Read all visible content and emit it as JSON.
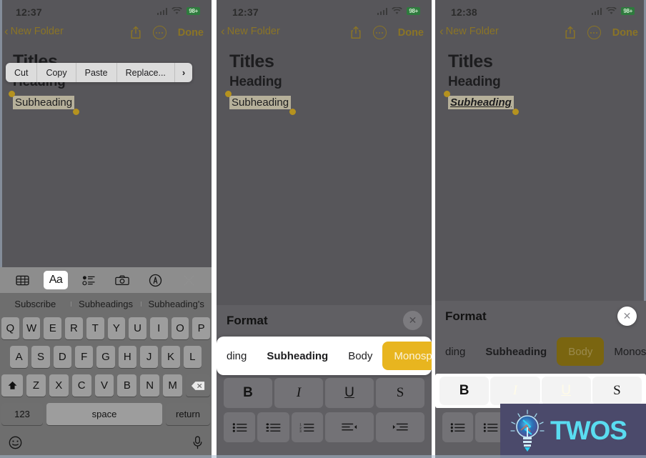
{
  "meta": {
    "accent_gold": "#8a7426",
    "selection_yellow": "#e8b51f",
    "body_bg": "#57565a",
    "battery_green": "#2f7a3e"
  },
  "panels": [
    {
      "id": "panel-1",
      "status": {
        "time": "12:37",
        "battery": "98+",
        "wifi_icon": "wifi-icon",
        "signal_icon": "cellular-signal-icon"
      },
      "nav": {
        "back_label": "New Folder",
        "back_icon": "chevron-left-icon",
        "share_icon": "share-icon",
        "more_icon": "more-ellipsis-icon",
        "done_label": "Done"
      },
      "note": {
        "title": "Titles",
        "heading": "Heading",
        "subheading": "Subheading"
      },
      "edit_menu": {
        "items": [
          "Cut",
          "Copy",
          "Paste",
          "Replace..."
        ],
        "more_icon": "chevron-right-icon"
      },
      "keyboard": {
        "toolbar": [
          {
            "name": "table-icon",
            "label": "",
            "active": false
          },
          {
            "name": "format-aa-icon",
            "label": "Aa",
            "active": true
          },
          {
            "name": "checklist-icon",
            "label": "",
            "active": false
          },
          {
            "name": "camera-icon",
            "label": "",
            "active": false
          },
          {
            "name": "markup-pen-icon",
            "label": "",
            "active": false
          },
          {
            "name": "close-icon",
            "label": "",
            "active": false
          }
        ],
        "predictions": [
          "Subscribe",
          "Subheadings",
          "Subheading's"
        ],
        "row1": [
          "Q",
          "W",
          "E",
          "R",
          "T",
          "Y",
          "U",
          "I",
          "O",
          "P"
        ],
        "row2": [
          "A",
          "S",
          "D",
          "F",
          "G",
          "H",
          "J",
          "K",
          "L"
        ],
        "row3": [
          "Z",
          "X",
          "C",
          "V",
          "B",
          "N",
          "M"
        ],
        "shift_icon": "shift-icon",
        "backspace_icon": "backspace-icon",
        "numbers_label": "123",
        "space_label": "space",
        "return_label": "return",
        "emoji_icon": "emoji-icon",
        "dictation_icon": "microphone-icon"
      }
    },
    {
      "id": "panel-2",
      "status": {
        "time": "12:37",
        "battery": "98+",
        "wifi_icon": "wifi-icon",
        "signal_icon": "cellular-signal-icon"
      },
      "nav": {
        "back_label": "New Folder",
        "back_icon": "chevron-left-icon",
        "share_icon": "share-icon",
        "more_icon": "more-ellipsis-icon",
        "done_label": "Done"
      },
      "note": {
        "title": "Titles",
        "heading": "Heading",
        "subheading": "Subheading"
      },
      "format": {
        "title": "Format",
        "close_icon": "close-circle-icon",
        "styles": [
          {
            "label": "ding",
            "state": "partial"
          },
          {
            "label": "Subheading",
            "state": "bold"
          },
          {
            "label": "Body",
            "state": "normal"
          },
          {
            "label": "Monospaced",
            "state": "selected"
          }
        ],
        "emphasis": [
          {
            "label": "B",
            "name": "bold-button",
            "on": false
          },
          {
            "label": "I",
            "name": "italic-button",
            "on": false
          },
          {
            "label": "U",
            "name": "underline-button",
            "on": false
          },
          {
            "label": "S",
            "name": "strikethrough-button",
            "on": false
          }
        ],
        "lists": [
          "bulleted-list-icon",
          "dashed-list-icon",
          "numbered-list-icon",
          "outdent-icon",
          "indent-icon"
        ]
      }
    },
    {
      "id": "panel-3",
      "status": {
        "time": "12:38",
        "battery": "98+",
        "wifi_icon": "wifi-icon",
        "signal_icon": "cellular-signal-icon"
      },
      "nav": {
        "back_label": "New Folder",
        "back_icon": "chevron-left-icon",
        "share_icon": "share-icon",
        "more_icon": "more-ellipsis-icon",
        "done_label": "Done"
      },
      "note": {
        "title": "Titles",
        "heading": "Heading",
        "subheading": "Subheading"
      },
      "format": {
        "title": "Format",
        "close_icon": "close-circle-icon",
        "styles": [
          {
            "label": "ding",
            "state": "partial"
          },
          {
            "label": "Subheading",
            "state": "bold"
          },
          {
            "label": "Body",
            "state": "selected-dim"
          },
          {
            "label": "Monospaced",
            "state": "normal"
          }
        ],
        "emphasis": [
          {
            "label": "B",
            "name": "bold-button",
            "on": false
          },
          {
            "label": "I",
            "name": "italic-button",
            "on": true
          },
          {
            "label": "U",
            "name": "underline-button",
            "on": true
          },
          {
            "label": "S",
            "name": "strikethrough-button",
            "on": false
          }
        ],
        "lists": [
          "bulleted-list-icon",
          "dashed-list-icon",
          "numbered-list-icon",
          "outdent-icon",
          "indent-icon"
        ]
      }
    }
  ],
  "watermark": {
    "text": "TWOS",
    "logo_icon": "lightbulb-logo-icon"
  }
}
